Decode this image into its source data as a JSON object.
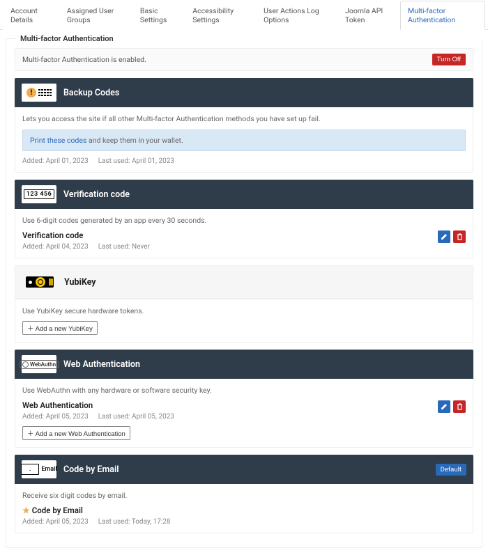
{
  "tabs": [
    {
      "label": "Account Details"
    },
    {
      "label": "Assigned User Groups"
    },
    {
      "label": "Basic Settings"
    },
    {
      "label": "Accessibility Settings"
    },
    {
      "label": "User Actions Log Options"
    },
    {
      "label": "Joomla API Token"
    },
    {
      "label": "Multi-factor Authentication"
    }
  ],
  "active_tab": 6,
  "legend": "Multi-factor Authentication",
  "status": {
    "text": "Multi-factor Authentication is enabled.",
    "button": "Turn Off"
  },
  "methods": {
    "backup": {
      "title": "Backup Codes",
      "desc": "Lets you access the site if all other Multi-factor Authentication methods you have set up fail.",
      "alert_link": "Print these codes",
      "alert_rest": " and keep them in your wallet.",
      "added": "Added: April 01, 2023",
      "last": "Last used: April 01, 2023"
    },
    "verification": {
      "title": "Verification code",
      "icon_text": "123 456",
      "desc": "Use 6-digit codes generated by an app every 30 seconds.",
      "instance_title": "Verification code",
      "added": "Added: April 04, 2023",
      "last": "Last used: Never"
    },
    "yubikey": {
      "title": "YubiKey",
      "desc": "Use YubiKey secure hardware tokens.",
      "add": "＋ Add a new YubiKey"
    },
    "webauthn": {
      "title": "Web Authentication",
      "icon_text": "WebAuthn",
      "desc": "Use WebAuthn with any hardware or software security key.",
      "instance_title": "Web Authentication",
      "added": "Added: April 05, 2023",
      "last": "Last used: April 05, 2023",
      "add": "＋ Add a new Web Authentication"
    },
    "email": {
      "title": "Code by Email",
      "icon_text": "Email",
      "default": "Default",
      "desc": "Receive six digit codes by email.",
      "instance_title": "Code by Email",
      "added": "Added: April 05, 2023",
      "last": "Last used: Today, 17:28"
    }
  }
}
